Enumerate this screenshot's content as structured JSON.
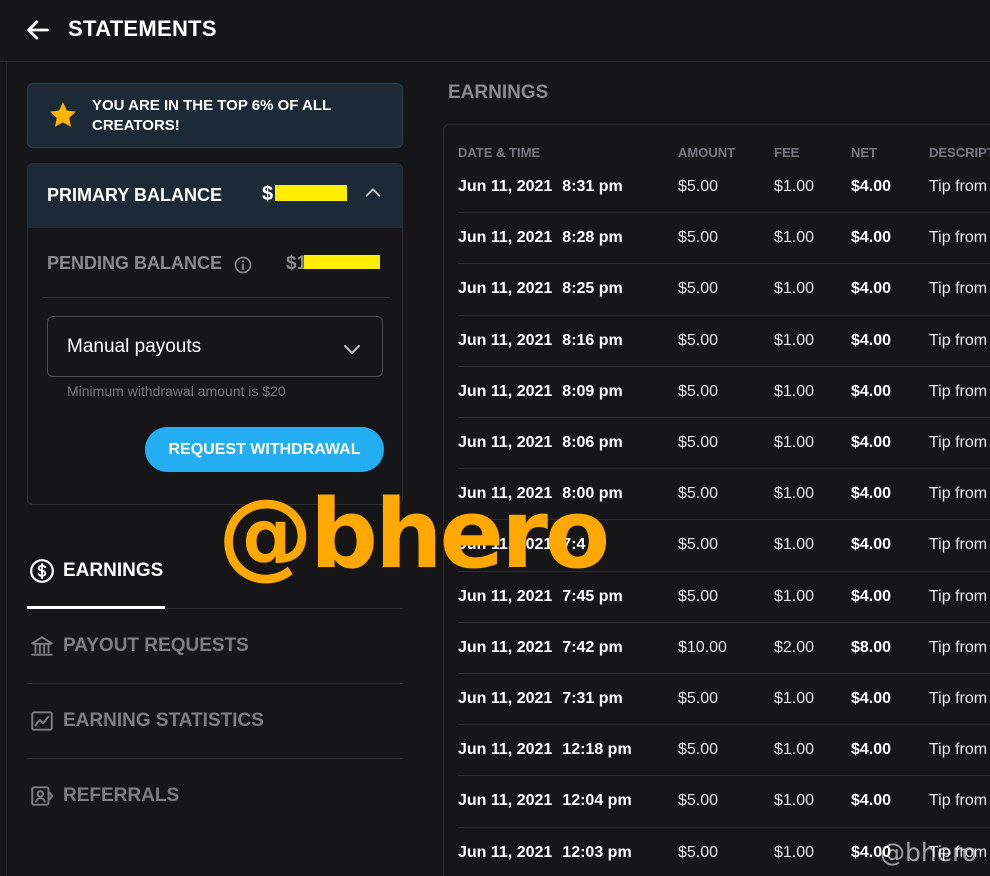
{
  "header": {
    "title": "STATEMENTS"
  },
  "banner": {
    "text": "YOU ARE IN THE TOP 6% OF ALL CREATORS!"
  },
  "primary_balance": {
    "label": "PRIMARY BALANCE",
    "amount_visible": "$"
  },
  "pending_balance": {
    "label": "PENDING BALANCE",
    "amount_visible": "$1"
  },
  "payout_select": {
    "value": "Manual payouts",
    "hint": "Minimum withdrawal amount is $20"
  },
  "withdraw_button": {
    "label": "REQUEST WITHDRAWAL"
  },
  "nav": {
    "earnings": "EARNINGS",
    "payout_requests": "PAYOUT REQUESTS",
    "earning_statistics": "EARNING STATISTICS",
    "referrals": "REFERRALS"
  },
  "earnings_section": {
    "title": "EARNINGS"
  },
  "table": {
    "headers": [
      "DATE & TIME",
      "AMOUNT",
      "FEE",
      "NET",
      "DESCRIPT"
    ],
    "rows": [
      {
        "date": "Jun 11, 2021",
        "time": "8:31 pm",
        "amount": "$5.00",
        "fee": "$1.00",
        "net": "$4.00",
        "desc": "Tip from"
      },
      {
        "date": "Jun 11, 2021",
        "time": "8:28 pm",
        "amount": "$5.00",
        "fee": "$1.00",
        "net": "$4.00",
        "desc": "Tip from"
      },
      {
        "date": "Jun 11, 2021",
        "time": "8:25 pm",
        "amount": "$5.00",
        "fee": "$1.00",
        "net": "$4.00",
        "desc": "Tip from"
      },
      {
        "date": "Jun 11, 2021",
        "time": "8:16 pm",
        "amount": "$5.00",
        "fee": "$1.00",
        "net": "$4.00",
        "desc": "Tip from"
      },
      {
        "date": "Jun 11, 2021",
        "time": "8:09 pm",
        "amount": "$5.00",
        "fee": "$1.00",
        "net": "$4.00",
        "desc": "Tip from"
      },
      {
        "date": "Jun 11, 2021",
        "time": "8:06 pm",
        "amount": "$5.00",
        "fee": "$1.00",
        "net": "$4.00",
        "desc": "Tip from"
      },
      {
        "date": "Jun 11, 2021",
        "time": "8:00 pm",
        "amount": "$5.00",
        "fee": "$1.00",
        "net": "$4.00",
        "desc": "Tip from"
      },
      {
        "date": "Jun 11, 2021",
        "time": "7:4",
        "amount": "$5.00",
        "fee": "$1.00",
        "net": "$4.00",
        "desc": "Tip from"
      },
      {
        "date": "Jun 11, 2021",
        "time": "7:45 pm",
        "amount": "$5.00",
        "fee": "$1.00",
        "net": "$4.00",
        "desc": "Tip from"
      },
      {
        "date": "Jun 11, 2021",
        "time": "7:42 pm",
        "amount": "$10.00",
        "fee": "$2.00",
        "net": "$8.00",
        "desc": "Tip from"
      },
      {
        "date": "Jun 11, 2021",
        "time": "7:31 pm",
        "amount": "$5.00",
        "fee": "$1.00",
        "net": "$4.00",
        "desc": "Tip from"
      },
      {
        "date": "Jun 11, 2021",
        "time": "12:18 pm",
        "amount": "$5.00",
        "fee": "$1.00",
        "net": "$4.00",
        "desc": "Tip from"
      },
      {
        "date": "Jun 11, 2021",
        "time": "12:04 pm",
        "amount": "$5.00",
        "fee": "$1.00",
        "net": "$4.00",
        "desc": "Tip from"
      },
      {
        "date": "Jun 11, 2021",
        "time": "12:03 pm",
        "amount": "$5.00",
        "fee": "$1.00",
        "net": "$4.00",
        "desc": "Tip from"
      }
    ]
  },
  "watermark": {
    "large": "@bhero",
    "small": "@bhero",
    "color": "#ffa800"
  },
  "colors": {
    "accent": "#22aef0",
    "star": "#ffb400",
    "banner_bg": "#1b2a36",
    "redaction": "#ffee00"
  },
  "icons": [
    "arrow-left-icon",
    "star-icon",
    "chevron-up-icon",
    "info-icon",
    "chevron-down-icon",
    "dollar-circle-icon",
    "bank-icon",
    "chart-icon",
    "referral-icon"
  ]
}
